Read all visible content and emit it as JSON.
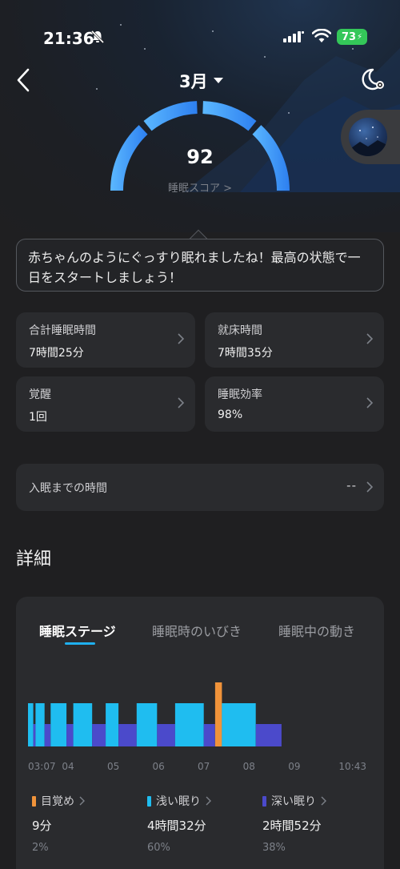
{
  "status_bar": {
    "time": "21:36",
    "battery": "73"
  },
  "header": {
    "month": "3月"
  },
  "score": {
    "value": "92",
    "link": "睡眠スコア >"
  },
  "message": "赤ちゃんのようにぐっすり眠れましたね！最高の状態で一日をスタートしましょう！",
  "metrics": [
    {
      "label": "合計睡眠時間",
      "value": "7時間25分"
    },
    {
      "label": "就床時間",
      "value": "7時間35分"
    },
    {
      "label": "覚醒",
      "value": "1回"
    },
    {
      "label": "睡眠効率",
      "value": "98%"
    }
  ],
  "sleep_latency": {
    "label": "入眠までの時間",
    "value": "--"
  },
  "details": {
    "title": "詳細",
    "tabs": [
      "睡眠ステージ",
      "睡眠時のいびき",
      "睡眠中の動き"
    ]
  },
  "colors": {
    "awake": "#f0933a",
    "light": "#1fbdf0",
    "deep": "#4b4acb",
    "accent": "#3a9bf5"
  },
  "chart_data": {
    "type": "bar",
    "x_labels": [
      "03:07",
      "04",
      "05",
      "06",
      "07",
      "08",
      "09",
      "10:43"
    ],
    "start": "03:07",
    "end": "10:43",
    "segments": [
      {
        "stage": "light",
        "start": "03:07",
        "end": "03:14"
      },
      {
        "stage": "deep",
        "start": "03:14",
        "end": "03:17"
      },
      {
        "stage": "light",
        "start": "03:17",
        "end": "03:29"
      },
      {
        "stage": "deep",
        "start": "03:29",
        "end": "03:37"
      },
      {
        "stage": "light",
        "start": "03:37",
        "end": "03:58"
      },
      {
        "stage": "deep",
        "start": "03:58",
        "end": "04:07"
      },
      {
        "stage": "light",
        "start": "04:07",
        "end": "04:32"
      },
      {
        "stage": "deep",
        "start": "04:32",
        "end": "04:50"
      },
      {
        "stage": "light",
        "start": "04:50",
        "end": "05:07"
      },
      {
        "stage": "deep",
        "start": "05:07",
        "end": "05:31"
      },
      {
        "stage": "light",
        "start": "05:31",
        "end": "05:58"
      },
      {
        "stage": "deep",
        "start": "05:58",
        "end": "06:22"
      },
      {
        "stage": "light",
        "start": "06:22",
        "end": "07:00"
      },
      {
        "stage": "deep",
        "start": "07:00",
        "end": "07:15"
      },
      {
        "stage": "awake",
        "start": "07:15",
        "end": "07:24"
      },
      {
        "stage": "light",
        "start": "07:24",
        "end": "08:09"
      },
      {
        "stage": "deep",
        "start": "08:09",
        "end": "08:43"
      }
    ],
    "legend": [
      {
        "stage": "awake",
        "name": "目覚め",
        "duration": "9分",
        "percent": "2%"
      },
      {
        "stage": "light",
        "name": "浅い眠り",
        "duration": "4時間32分",
        "percent": "60%"
      },
      {
        "stage": "deep",
        "name": "深い眠り",
        "duration": "2時間52分",
        "percent": "38%"
      }
    ]
  }
}
